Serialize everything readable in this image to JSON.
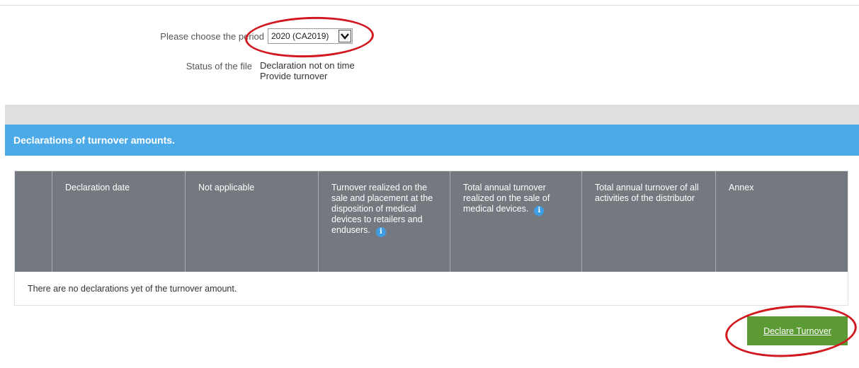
{
  "filters": {
    "period_label": "Please choose the period",
    "period_value": "2020 (CA2019)",
    "status_label": "Status of the file",
    "status_lines": [
      "Declaration not on time",
      "Provide turnover"
    ]
  },
  "section": {
    "title": "Declarations of turnover amounts."
  },
  "table": {
    "columns": [
      {
        "label": ""
      },
      {
        "label": "Declaration date"
      },
      {
        "label": "Not applicable"
      },
      {
        "label": "Turnover realized on the sale and placement at the disposition of medical devices to retailers and endusers."
      },
      {
        "label": "Total annual turnover realized on the sale of medical devices."
      },
      {
        "label": "Total annual turnover of all activities of the distributor"
      },
      {
        "label": "Annex"
      }
    ],
    "empty_message": "There are no declarations yet of the turnover amount."
  },
  "actions": {
    "declare_label": "Declare Turnover"
  },
  "icons": {
    "info": "info-icon",
    "dropdown": "chevron-down-icon"
  },
  "colors": {
    "header_bar": "#4daae8",
    "table_header": "#74787f",
    "button": "#5c9a34",
    "annotation": "#d11820"
  }
}
